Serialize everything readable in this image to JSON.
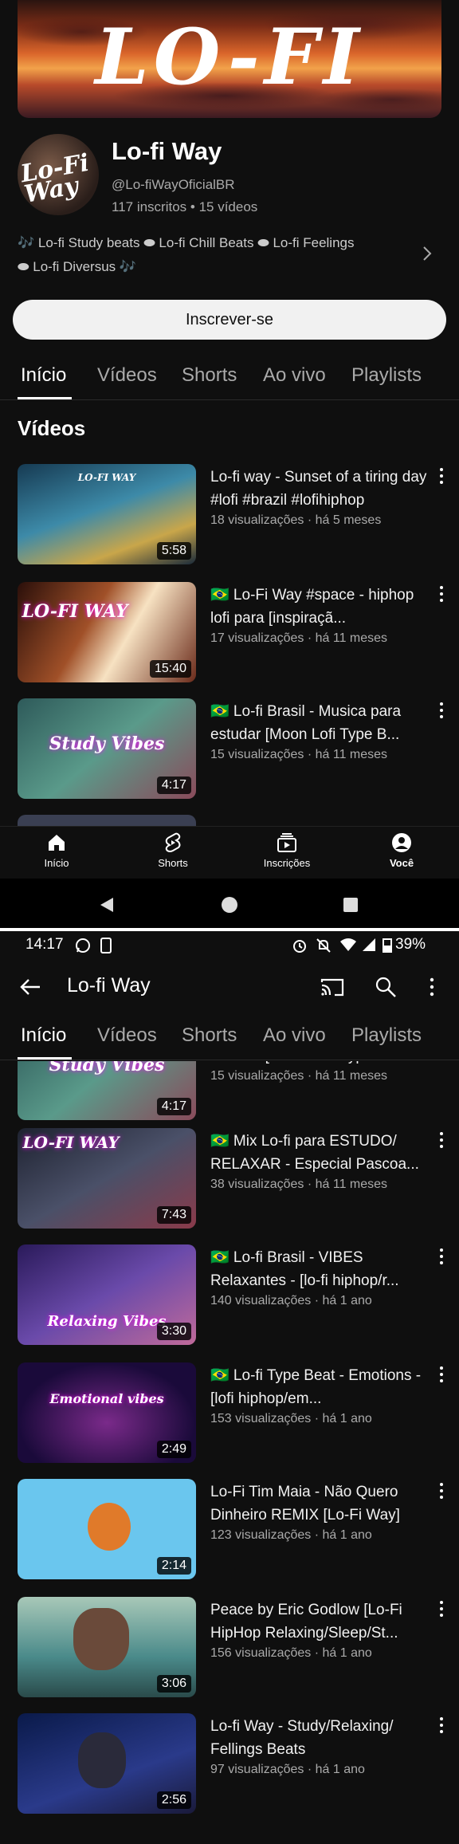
{
  "channel": {
    "banner_text": "LO-FI WAY",
    "avatar_text": "Lo-Fi Way",
    "name": "Lo-fi Way",
    "handle": "@Lo-fiWayOficialBR",
    "stats": "117 inscritos • 15 vídeos",
    "links_line1": "🎶 Lo-fi Study beats ⬬ Lo-fi Chill Beats ⬬ Lo-fi Feelings",
    "links_line2": "⬬ Lo-fi Diversus 🎶",
    "subscribe_label": "Inscrever-se"
  },
  "tabs": [
    "Início",
    "Vídeos",
    "Shorts",
    "Ao vivo",
    "Playlists"
  ],
  "section_title": "Vídeos",
  "videos": [
    {
      "thumb_text": "LO-FI WAY",
      "duration": "5:58",
      "title": "Lo-fi way - Sunset of a tiring day #lofi #brazil #lofihiphop",
      "meta": "18 visualizações · há 5 meses",
      "bg": "#2f6f87"
    },
    {
      "thumb_text": "LO-FI WAY",
      "duration": "15:40",
      "title": "🇧🇷 Lo-Fi Way #space  - hiphop lofi para [inspiraçã...",
      "meta": "17 visualizações · há 11 meses",
      "bg": "#7a3a1a"
    },
    {
      "thumb_text": "Study Vibes",
      "duration": "4:17",
      "title": "🇧🇷 Lo-fi Brasil - Musica para estudar [Moon Lofi Type B...",
      "meta": "15 visualizações · há 11 meses",
      "bg": "#3f7a7a"
    },
    {
      "thumb_text": "LO-FI WAY",
      "duration": "7:43",
      "title": "🇧🇷 Mix Lo-fi para ESTUDO/ RELAXAR - Especial Pascoa...",
      "meta": "38 visualizações · há 11 meses",
      "bg": "#3a3f52"
    },
    {
      "thumb_text": "Relaxing Vibes",
      "duration": "3:30",
      "title": "🇧🇷 Lo-fi Brasil - VIBES Relaxantes - [lo-fi hiphop/r...",
      "meta": "140 visualizações · há 1 ano",
      "bg": "#5a3a8a"
    },
    {
      "thumb_text": "Emotional vibes",
      "duration": "2:49",
      "title": "🇧🇷 Lo-fi Type Beat - Emotions - [lofi hiphop/em...",
      "meta": "153 visualizações · há 1 ano",
      "bg": "#3a1a5a"
    },
    {
      "thumb_text": "",
      "duration": "2:14",
      "title": "Lo-Fi Tim Maia - Não Quero Dinheiro REMIX [Lo-Fi Way]",
      "meta": "123 visualizações · há 1 ano",
      "bg": "#6ac6ee"
    },
    {
      "thumb_text": "",
      "duration": "3:06",
      "title": "Peace by  Eric Godlow [Lo-Fi HipHop Relaxing/Sleep/St...",
      "meta": "156 visualizações · há 1 ano",
      "bg": "#4a8a8a"
    },
    {
      "thumb_text": "",
      "duration": "2:56",
      "title": "Lo-fi Way - Study/Relaxing/ Fellings Beats",
      "meta": "97 visualizações · há 1 ano",
      "bg": "#1a2a5a"
    }
  ],
  "bottom_nav": [
    "Início",
    "Shorts",
    "Inscrições",
    "Você"
  ],
  "status_bar": {
    "time": "14:17",
    "battery": "39%"
  },
  "app_bar": {
    "title": "Lo-fi Way"
  }
}
